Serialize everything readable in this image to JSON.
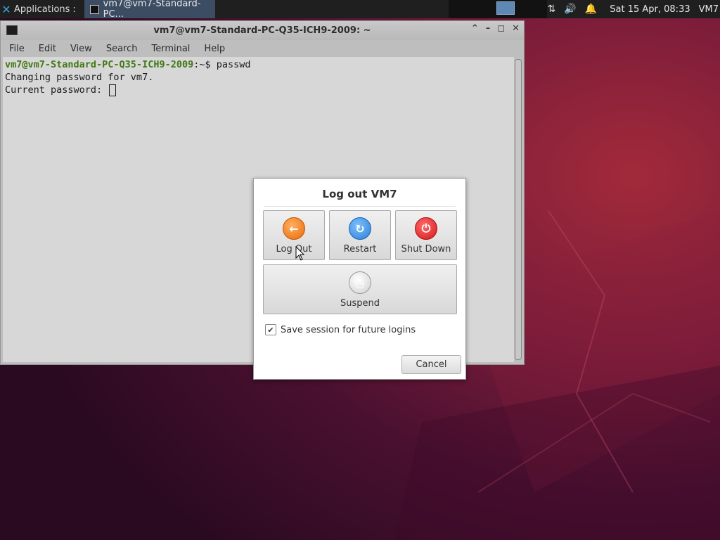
{
  "panel": {
    "applications_label": "Applications",
    "applications_suffix": ":",
    "task_title": "vm7@vm7-Standard-PC...",
    "datetime": "Sat 15 Apr, 08:33",
    "user_short": "VM7"
  },
  "terminal": {
    "title": "vm7@vm7-Standard-PC-Q35-ICH9-2009: ~",
    "menu": [
      "File",
      "Edit",
      "View",
      "Search",
      "Terminal",
      "Help"
    ],
    "prompt_user": "vm7@vm7-Standard-PC-Q35-ICH9-2009",
    "prompt_rest": ":~$ passwd",
    "line2": "Changing password for vm7.",
    "line3": "Current password: "
  },
  "dialog": {
    "title": "Log out VM7",
    "logout_label": "Log Out",
    "restart_label": "Restart",
    "shutdown_label": "Shut Down",
    "suspend_label": "Suspend",
    "save_session_label": "Save session for future logins",
    "save_session_checked": true,
    "cancel_label": "Cancel"
  },
  "colors": {
    "logout_icon": "#e86a0c",
    "restart_icon": "#2b7fd6",
    "shutdown_icon": "#d41a1a",
    "prompt_green": "#4b8a1a"
  }
}
